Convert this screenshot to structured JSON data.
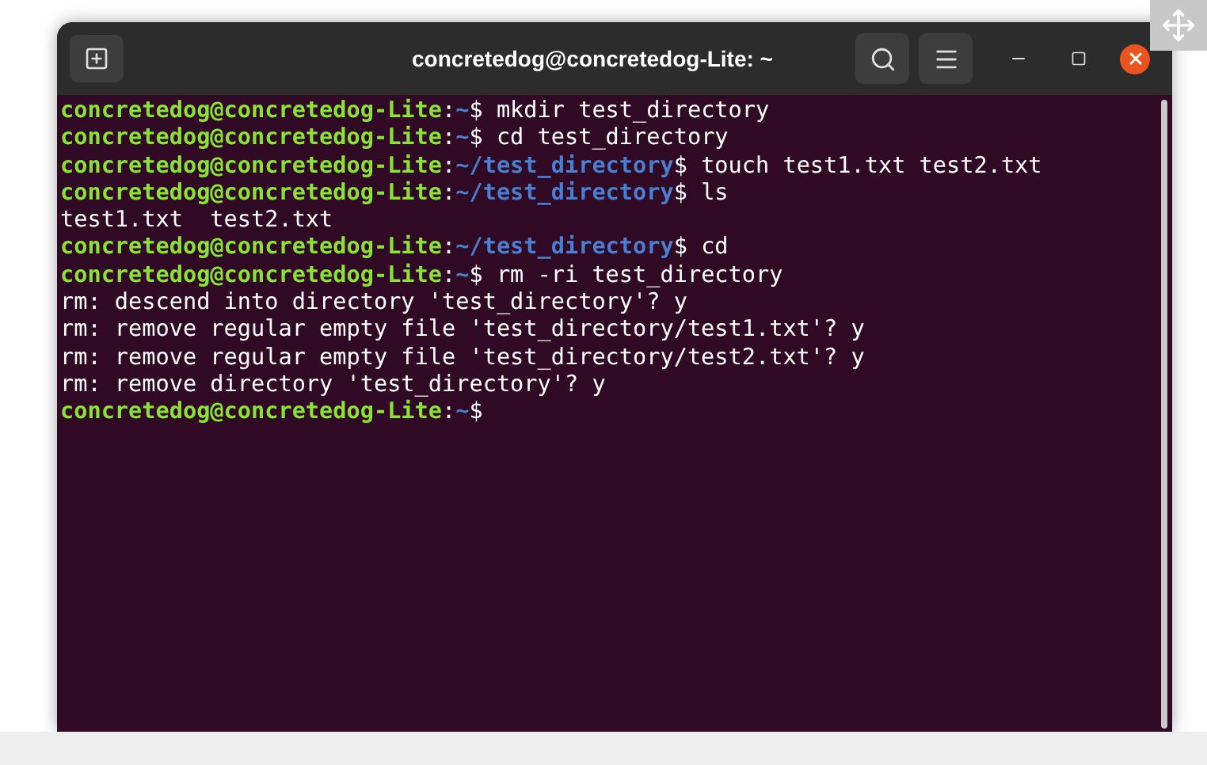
{
  "window": {
    "title": "concretedog@concretedog-Lite: ~"
  },
  "terminal": {
    "lines": [
      {
        "kind": "prompt",
        "user_host": "concretedog@concretedog-Lite",
        "separator": ":",
        "path": "~",
        "symbol": "$",
        "command": "mkdir test_directory"
      },
      {
        "kind": "prompt",
        "user_host": "concretedog@concretedog-Lite",
        "separator": ":",
        "path": "~",
        "symbol": "$",
        "command": "cd test_directory"
      },
      {
        "kind": "prompt",
        "user_host": "concretedog@concretedog-Lite",
        "separator": ":",
        "path": "~/test_directory",
        "symbol": "$",
        "command": "touch test1.txt test2.txt"
      },
      {
        "kind": "prompt",
        "user_host": "concretedog@concretedog-Lite",
        "separator": ":",
        "path": "~/test_directory",
        "symbol": "$",
        "command": "ls"
      },
      {
        "kind": "output",
        "text": "test1.txt  test2.txt"
      },
      {
        "kind": "prompt",
        "user_host": "concretedog@concretedog-Lite",
        "separator": ":",
        "path": "~/test_directory",
        "symbol": "$",
        "command": "cd"
      },
      {
        "kind": "prompt",
        "user_host": "concretedog@concretedog-Lite",
        "separator": ":",
        "path": "~",
        "symbol": "$",
        "command": "rm -ri test_directory"
      },
      {
        "kind": "output",
        "text": "rm: descend into directory 'test_directory'? y"
      },
      {
        "kind": "output",
        "text": "rm: remove regular empty file 'test_directory/test1.txt'? y"
      },
      {
        "kind": "output",
        "text": "rm: remove regular empty file 'test_directory/test2.txt'? y"
      },
      {
        "kind": "output",
        "text": "rm: remove directory 'test_directory'? y"
      },
      {
        "kind": "prompt",
        "user_host": "concretedog@concretedog-Lite",
        "separator": ":",
        "path": "~",
        "symbol": "$"
      }
    ]
  }
}
